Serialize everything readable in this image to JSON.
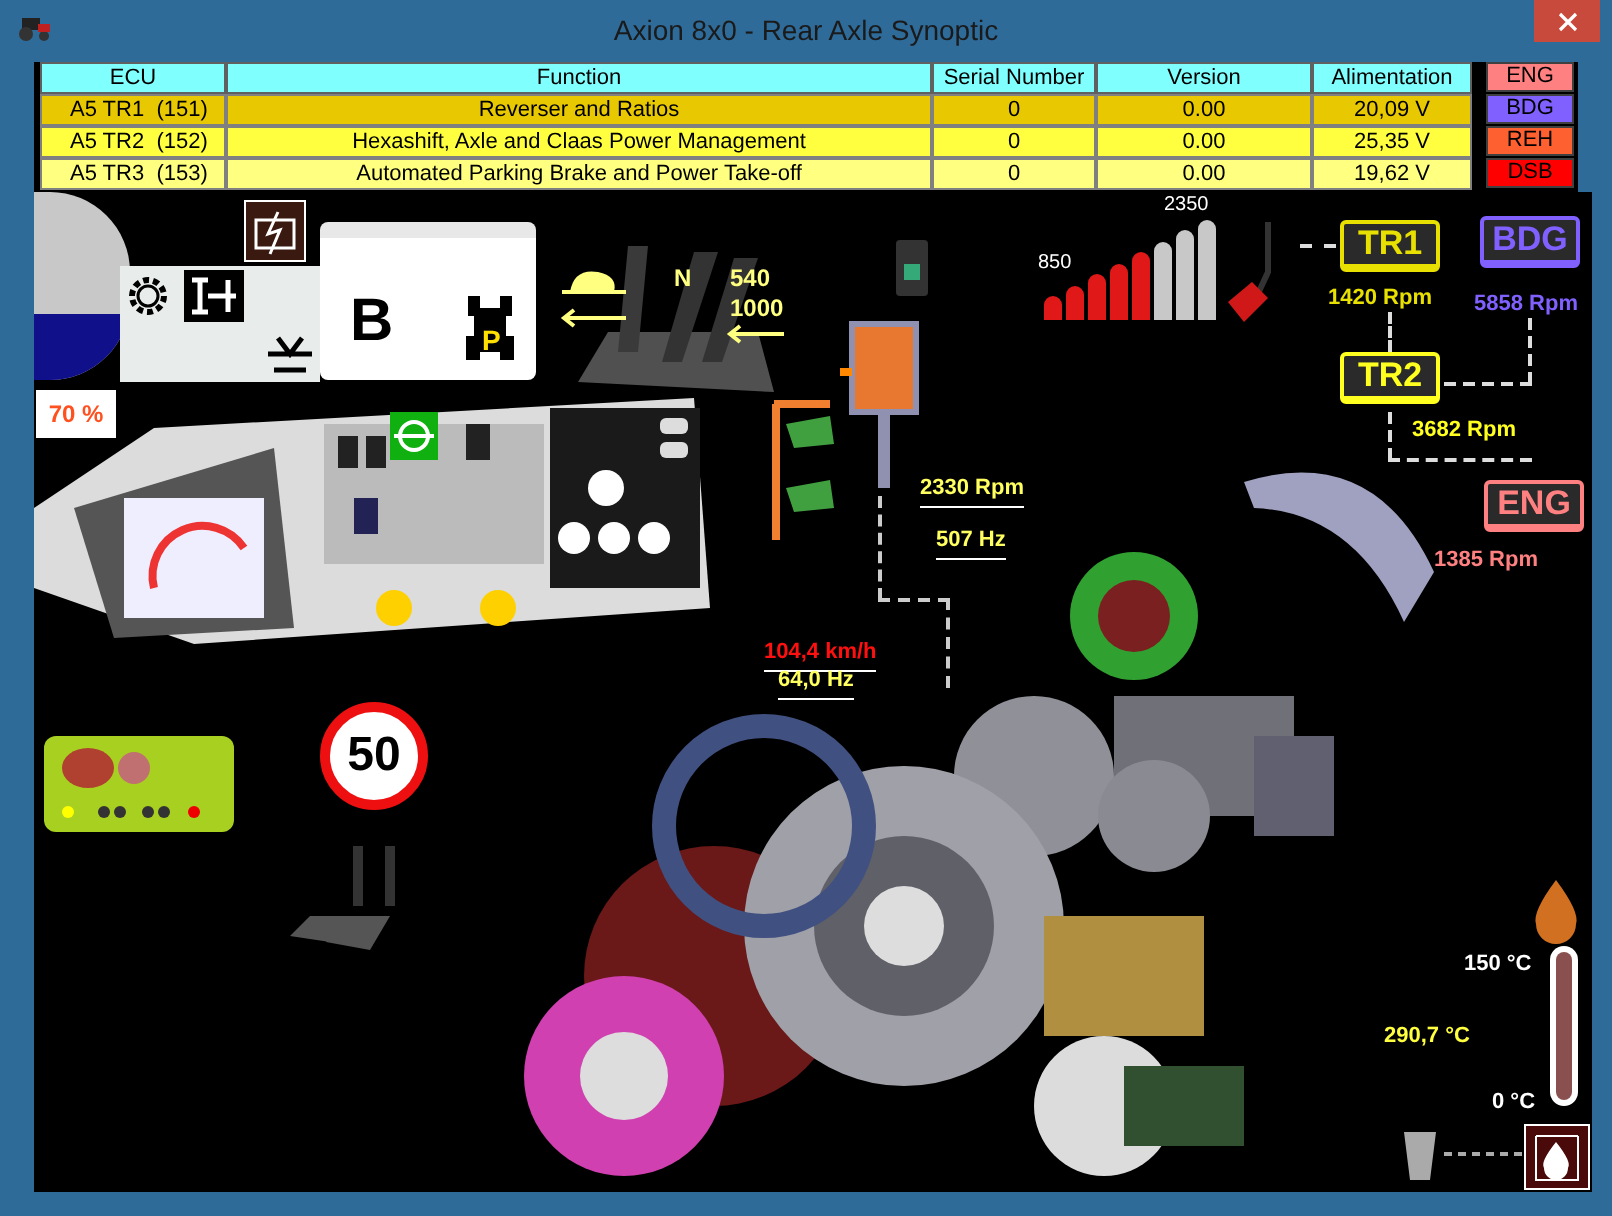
{
  "window": {
    "title": "Axion 8x0 - Rear Axle Synoptic"
  },
  "ecu_table": {
    "columns": [
      "ECU",
      "Function",
      "Serial Number",
      "Version",
      "Alimentation"
    ],
    "rows": [
      {
        "cells": [
          "A5 TR1  (151)",
          "Reverser and Ratios",
          "0",
          "0.00",
          "20,09 V"
        ],
        "color": "#e8c800"
      },
      {
        "cells": [
          "A5 TR2  (152)",
          "Hexashift, Axle and Claas Power Management",
          "0",
          "0.00",
          "25,35 V"
        ],
        "color": "#ffff40"
      },
      {
        "cells": [
          "A5 TR3  (153)",
          "Automated Parking Brake and Power Take-off",
          "0",
          "0.00",
          "19,62 V"
        ],
        "color": "#ffff80"
      }
    ]
  },
  "ecu_status": [
    {
      "label": "ENG",
      "color": "#ff8080"
    },
    {
      "label": "BDG",
      "color": "#8060ff"
    },
    {
      "label": "REH",
      "color": "#ff6030"
    },
    {
      "label": "DSB",
      "color": "#ff0000"
    }
  ],
  "battery": {
    "level": 0.35,
    "reading": "70 %"
  },
  "mode_panel": {
    "range": "B",
    "park": "P"
  },
  "pto": {
    "neutral": "N",
    "speeds": [
      "540",
      "1000"
    ]
  },
  "engine_speed": {
    "level": 0.625,
    "min": "850",
    "max": "2350"
  },
  "nodes": [
    {
      "label": "TR1",
      "reading": "1420 Rpm",
      "color": "#e8e000"
    },
    {
      "label": "BDG",
      "reading": "5858 Rpm",
      "color": "#8060ff"
    },
    {
      "label": "TR2",
      "reading": "3682 Rpm",
      "color": "#ffff20"
    },
    {
      "label": "ENG",
      "reading": "1385 Rpm",
      "color": "#ff8080"
    }
  ],
  "sensors": [
    {
      "reading": "2330 Rpm",
      "alert": false
    },
    {
      "reading": "507 Hz",
      "alert": false
    },
    {
      "reading": "104,4 km/h",
      "alert": true
    },
    {
      "reading": "64,0 Hz",
      "alert": false
    }
  ],
  "speed_limit": "50",
  "temperature": {
    "max": "150 °C",
    "value": "290,7 °C",
    "min": "0 °C",
    "level": 1
  }
}
